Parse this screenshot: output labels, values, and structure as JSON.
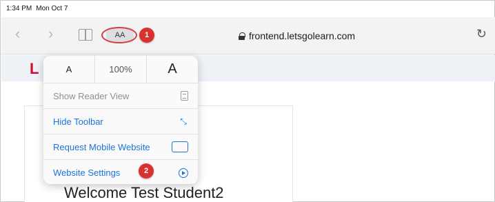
{
  "status_bar": {
    "time": "1:34 PM",
    "date": "Mon Oct 7"
  },
  "toolbar": {
    "back_icon": "chevron-left-icon",
    "forward_icon": "chevron-right-icon",
    "bookmarks_icon": "book-icon",
    "aa_label": "AA",
    "url": "frontend.letsgolearn.com",
    "reload_icon": "reload-icon",
    "accent_color": "#1a73d9",
    "badge_color": "#d8322f"
  },
  "annotations": {
    "badge_1": "1",
    "badge_2": "2"
  },
  "popover": {
    "text_small": "A",
    "zoom": "100%",
    "text_large": "A",
    "items": [
      {
        "label": "Show Reader View",
        "icon": "reader-view-icon",
        "enabled": false
      },
      {
        "label": "Hide Toolbar",
        "icon": "expand-arrows-icon",
        "enabled": true
      },
      {
        "label": "Request Mobile Website",
        "icon": "mobile-device-icon",
        "enabled": true
      },
      {
        "label": "Website Settings",
        "icon": "settings-icon",
        "enabled": true
      }
    ]
  },
  "page": {
    "logo_letter": "L",
    "welcome": "Welcome Test Student2"
  }
}
